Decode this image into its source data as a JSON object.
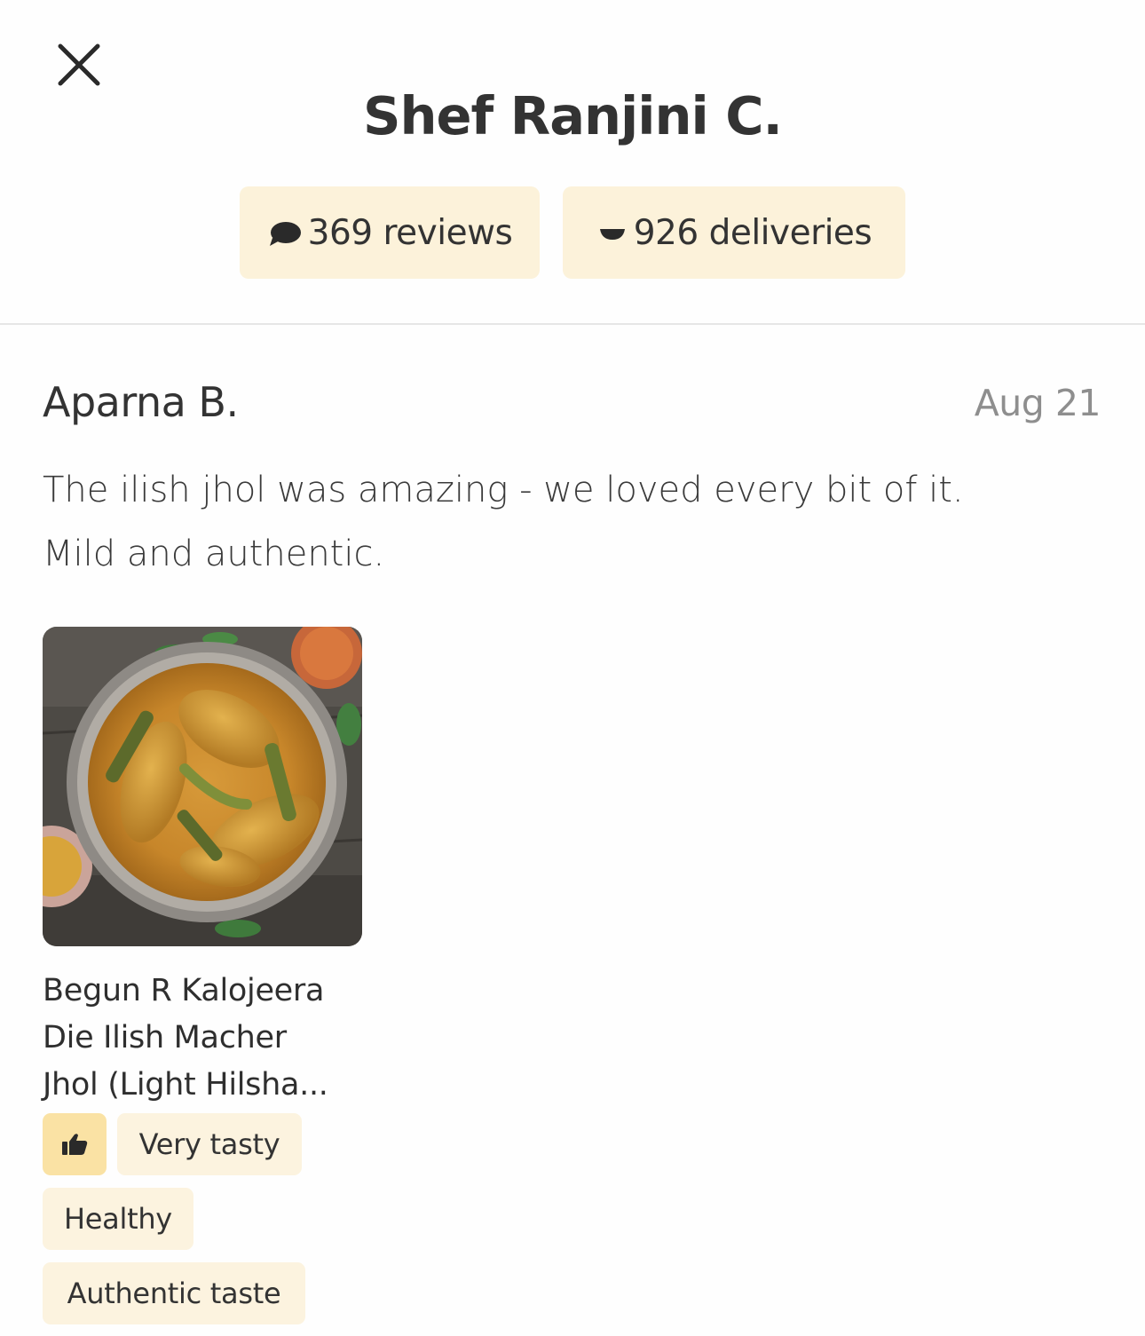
{
  "header": {
    "title": "Shef Ranjini C.",
    "close_icon": "close-icon"
  },
  "stats": {
    "reviews": {
      "icon": "speech-bubble-icon",
      "label": "369 reviews"
    },
    "deliveries": {
      "icon": "bowl-icon",
      "label": "926 deliveries"
    }
  },
  "review": {
    "author": "Aparna B.",
    "date": "Aug 21",
    "text_line1": "The ilish jhol was amazing - we loved every bit of it.",
    "text_line2": "Mild and authentic.",
    "dish": {
      "photo": "dish-photo",
      "name_line1": "Begun R Kalojeera",
      "name_line2": "Die Ilish Macher",
      "name_line3": "Jhol (Light Hilsha..."
    },
    "tags": {
      "thumb_icon": "thumbs-up-icon",
      "items": [
        "Very tasty",
        "Healthy",
        "Authentic taste"
      ]
    }
  },
  "colors": {
    "pill_bg": "#fcf2da",
    "thumb_bg": "#fae2a4",
    "text": "#333333",
    "muted": "#8e8e8e",
    "divider": "#e6e6e6"
  }
}
